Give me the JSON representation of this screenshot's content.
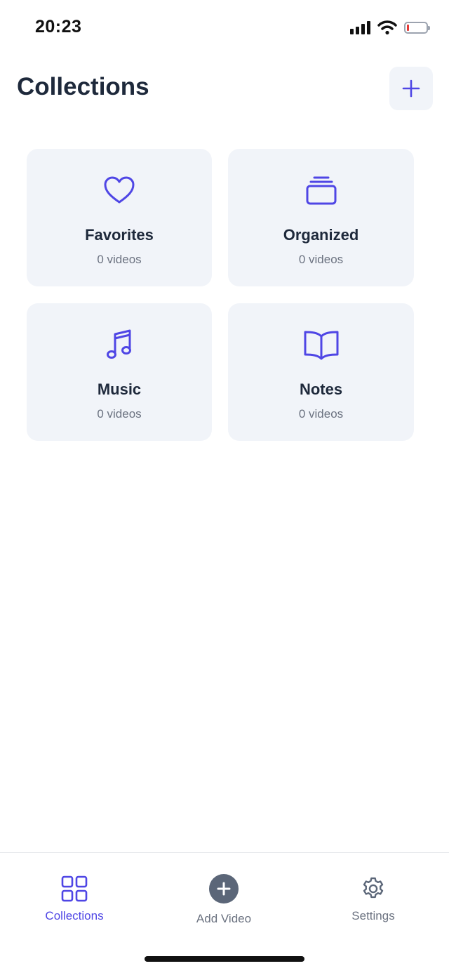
{
  "status_bar": {
    "time": "20:23"
  },
  "header": {
    "title": "Collections",
    "add_button_icon": "plus-icon"
  },
  "collections": [
    {
      "name": "Favorites",
      "count": "0 videos",
      "icon": "heart-icon"
    },
    {
      "name": "Organized",
      "count": "0 videos",
      "icon": "stack-icon"
    },
    {
      "name": "Music",
      "count": "0 videos",
      "icon": "music-note-icon"
    },
    {
      "name": "Notes",
      "count": "0 videos",
      "icon": "open-book-icon"
    }
  ],
  "tab_bar": {
    "tabs": [
      {
        "label": "Collections",
        "icon": "grid-icon",
        "active": true
      },
      {
        "label": "Add Video",
        "icon": "plus-circle-icon",
        "active": false
      },
      {
        "label": "Settings",
        "icon": "gear-icon",
        "active": false
      }
    ]
  },
  "colors": {
    "accent": "#4f46e5",
    "card_bg": "#f1f4f9",
    "muted_text": "#6b7280",
    "title_text": "#1e293b"
  }
}
